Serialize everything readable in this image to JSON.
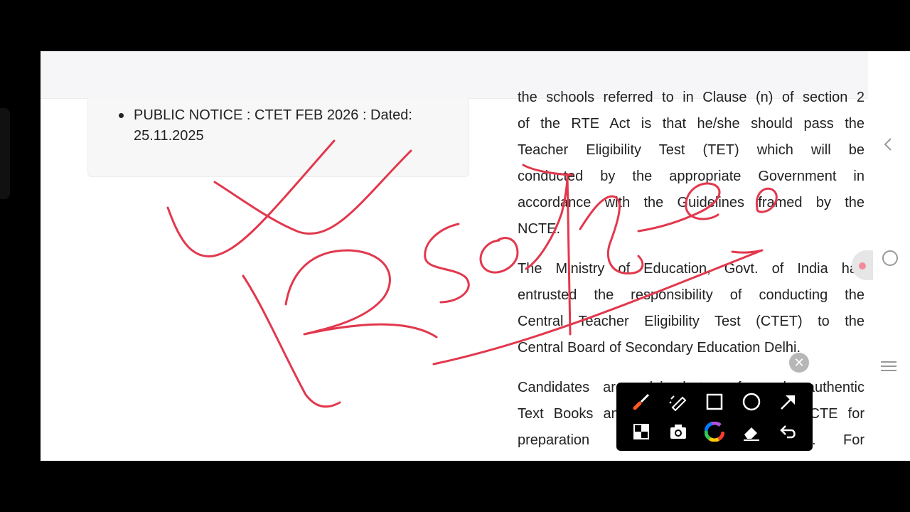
{
  "notice": {
    "text": "PUBLIC NOTICE : CTET FEB 2026 : Dated: 25.11.2025"
  },
  "article": {
    "paragraph1_lines": [
      "the schools referred to in Clause (n) of section 2",
      "of the RTE Act is that he/she should pass the",
      "Teacher Eligibility Test (TET) which will be",
      "conducted by the appropriate Government in",
      "accordance with the Guidelines framed by the",
      "NCTE."
    ],
    "paragraph2_lines": [
      "The Ministry of Education, Govt. of India has",
      "entrusted the responsibility of conducting the",
      "Central Teacher Eligibility Test (CTET) to the",
      "Central Board of Secondary Education Delhi."
    ],
    "paragraph3_lines": [
      "Candidates are advised to refer only authentic",
      "Text Books and syllabus suggested by NCTE for",
      "preparation in area of education. For"
    ]
  },
  "side_icons": [
    "chevron-left-icon",
    "circle-icon",
    "menu-icon"
  ],
  "toolbar": {
    "tools": [
      "brush-icon",
      "highlighter-icon",
      "rectangle-icon",
      "circle-icon",
      "arrow-icon",
      "mosaic-icon",
      "camera-icon",
      "color-wheel-icon",
      "eraser-icon",
      "undo-icon"
    ],
    "accent_color": "#ff5a1f"
  },
  "ink_color": "#e2384d"
}
